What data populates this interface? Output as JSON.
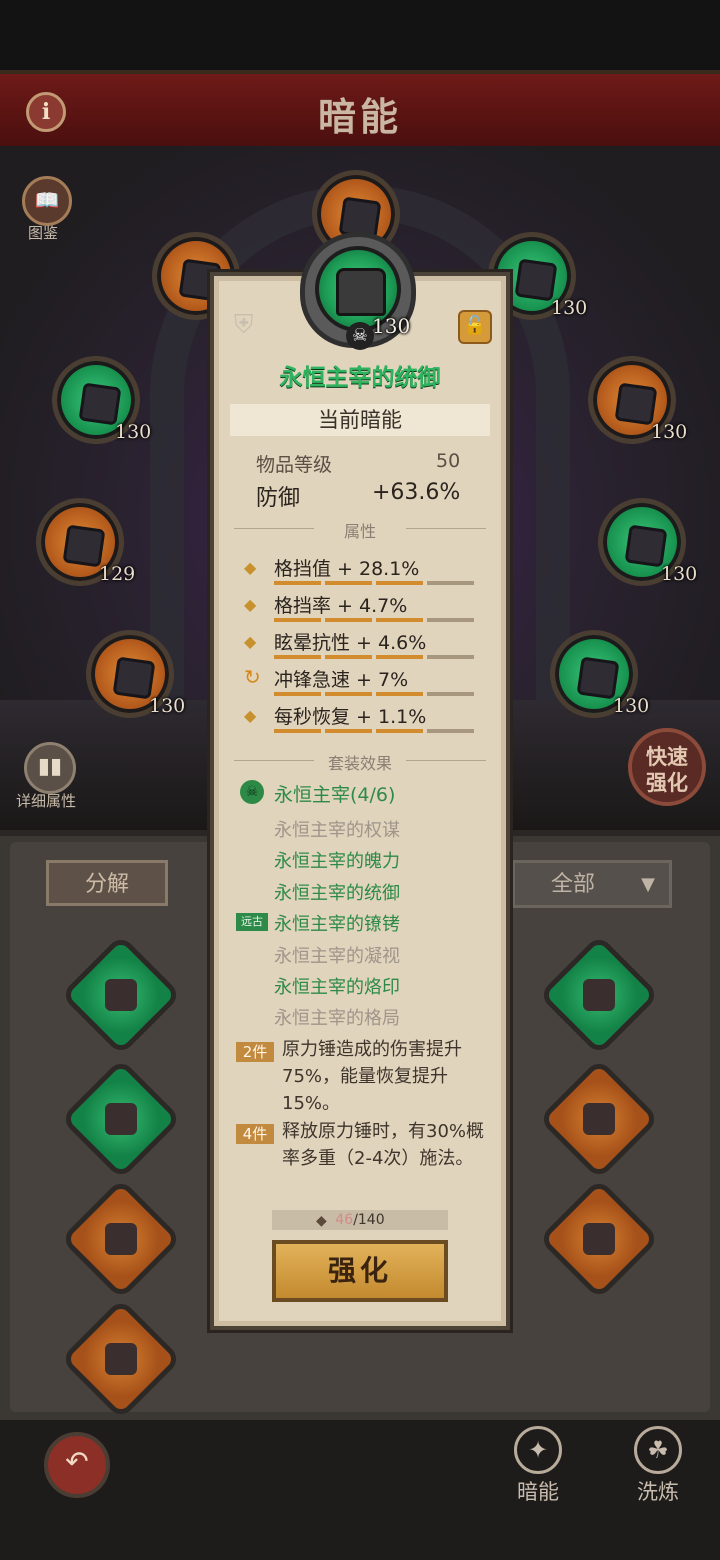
{
  "header": {
    "title": "暗能",
    "info_icon": "i"
  },
  "side": {
    "codex_label": "图鉴",
    "stats_label": "详细属性",
    "quick_upgrade_label": "快速强化"
  },
  "slots": [
    {
      "level": "130"
    },
    {
      "level": "130"
    },
    {
      "level": "130"
    },
    {
      "level": "130"
    },
    {
      "level": "129"
    },
    {
      "level": "130"
    },
    {
      "level": "130"
    },
    {
      "level": "130"
    }
  ],
  "inventory": {
    "disassemble_label": "分解",
    "filter_label": "全部"
  },
  "item": {
    "name": "永恒主宰的统御",
    "level": "130",
    "current_tab": "当前暗能",
    "item_level_label": "物品等级",
    "item_level_value": "50",
    "main_stat_label": "防御",
    "main_stat_value": "+63.6%",
    "attributes_title": "属性",
    "attributes": [
      {
        "text": "格挡值 + 28.1%",
        "bullet": "diamond",
        "bar_level": 0.85
      },
      {
        "text": "格挡率 + 4.7%",
        "bullet": "diamond",
        "bar_level": 0.85
      },
      {
        "text": "眩晕抗性 + 4.6%",
        "bullet": "diamond",
        "bar_level": 0.85
      },
      {
        "text": "冲锋急速 + 7%",
        "bullet": "swirl",
        "bar_level": 0.85
      },
      {
        "text": "每秒恢复 + 1.1%",
        "bullet": "diamond",
        "bar_level": 0.85
      }
    ],
    "set_title": "套装效果",
    "set_name": "永恒主宰(4/6)",
    "set_pieces": [
      {
        "name": "永恒主宰的权谋",
        "owned": false
      },
      {
        "name": "永恒主宰的魄力",
        "owned": true
      },
      {
        "name": "永恒主宰的统御",
        "owned": true
      },
      {
        "name": "永恒主宰的镣铐",
        "owned": true,
        "tag": "远古"
      },
      {
        "name": "永恒主宰的凝视",
        "owned": false
      },
      {
        "name": "永恒主宰的烙印",
        "owned": true
      },
      {
        "name": "永恒主宰的格局",
        "owned": false
      }
    ],
    "bonuses": [
      {
        "tag": "2件",
        "text": "原力锤造成的伤害提升75%，能量恢复提升15%。"
      },
      {
        "tag": "4件",
        "text": "释放原力锤时，有30%概率多重（2-4次）施法。"
      }
    ],
    "material_current": "46",
    "material_max": "/140",
    "upgrade_label": "强化"
  },
  "nav": {
    "dark_energy_label": "暗能",
    "refine_label": "洗炼"
  },
  "colors": {
    "epic_green": "#2eb35e",
    "legend_orange": "#c7922e",
    "set_green": "#2e8a48"
  }
}
